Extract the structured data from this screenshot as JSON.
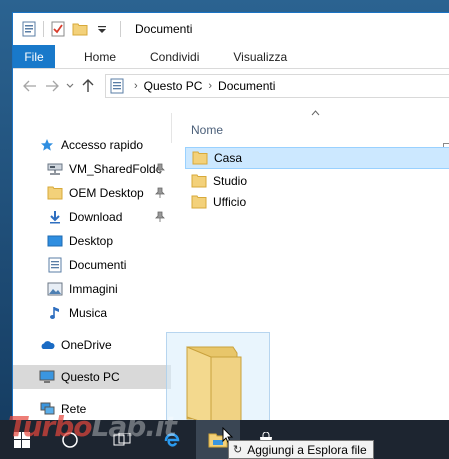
{
  "window": {
    "title": "Documenti"
  },
  "ribbon": {
    "tabs": [
      "File",
      "Home",
      "Condividi",
      "Visualizza"
    ]
  },
  "address": {
    "breadcrumb": [
      "Questo PC",
      "Documenti"
    ]
  },
  "navigation": {
    "items": [
      {
        "label": "Accesso rapido",
        "icon": "star-icon",
        "pinned": false
      },
      {
        "label": "VM_SharedFolde",
        "icon": "network-drive-icon",
        "pinned": true
      },
      {
        "label": "OEM Desktop",
        "icon": "folder-icon",
        "pinned": true
      },
      {
        "label": "Download",
        "icon": "download-icon",
        "pinned": true
      },
      {
        "label": "Desktop",
        "icon": "desktop-icon",
        "pinned": false
      },
      {
        "label": "Documenti",
        "icon": "documents-icon",
        "pinned": false
      },
      {
        "label": "Immagini",
        "icon": "pictures-icon",
        "pinned": false
      },
      {
        "label": "Musica",
        "icon": "music-icon",
        "pinned": false
      },
      {
        "label": "OneDrive",
        "icon": "cloud-icon",
        "pinned": false
      },
      {
        "label": "Questo PC",
        "icon": "computer-icon",
        "pinned": false,
        "selected": true
      },
      {
        "label": "Rete",
        "icon": "network-icon",
        "pinned": false
      }
    ]
  },
  "content": {
    "column_header": "Nome",
    "files": [
      {
        "name": "Casa",
        "selected": true
      },
      {
        "name": "Studio",
        "selected": false
      },
      {
        "name": "Ufficio",
        "selected": false
      }
    ]
  },
  "tooltip": {
    "text": "Aggiungi a Esplora file"
  },
  "watermark": {
    "text": "TurboLab.it"
  },
  "colors": {
    "file_tab": "#1979ca",
    "selection": "#cce8ff",
    "folder": "#f3d17a",
    "taskbar": "#1d2530"
  }
}
